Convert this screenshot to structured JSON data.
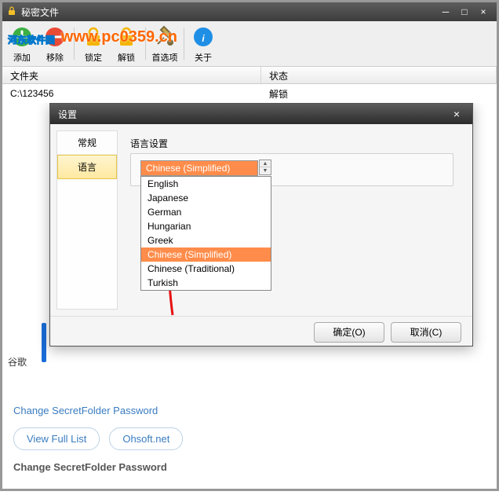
{
  "window": {
    "title": "秘密文件",
    "minimize": "─",
    "maximize": "□",
    "close": "×"
  },
  "toolbar": {
    "add": "添加",
    "remove": "移除",
    "lock": "锁定",
    "unlock": "解锁",
    "preferences": "首选项",
    "about": "关于"
  },
  "table": {
    "col_folder": "文件夹",
    "col_status": "状态",
    "rows": [
      {
        "folder": "C:\\123456",
        "status": "解锁"
      }
    ]
  },
  "dialog": {
    "title": "设置",
    "close": "×",
    "tabs": {
      "general": "常规",
      "language": "语言"
    },
    "lang_section_label": "语言设置",
    "selected_language": "Chinese (Simplified)",
    "options": [
      "English",
      "Japanese",
      "German",
      "Hungarian",
      "Greek",
      "Chinese (Simplified)",
      "Chinese (Traditional)",
      "Turkish"
    ],
    "highlighted_index": 5,
    "ok_button": "确定(O)",
    "cancel_button": "取消(C)"
  },
  "footer": {
    "partial": "谷歌",
    "change_pw_link": "Change SecretFolder Password",
    "view_full_list": "View Full List",
    "ohsoft": "Ohsoft.net",
    "change_pw_heading": "Change SecretFolder Password"
  },
  "watermark": {
    "hd": "河东软件园",
    "url": "www.pc0359.cn"
  }
}
